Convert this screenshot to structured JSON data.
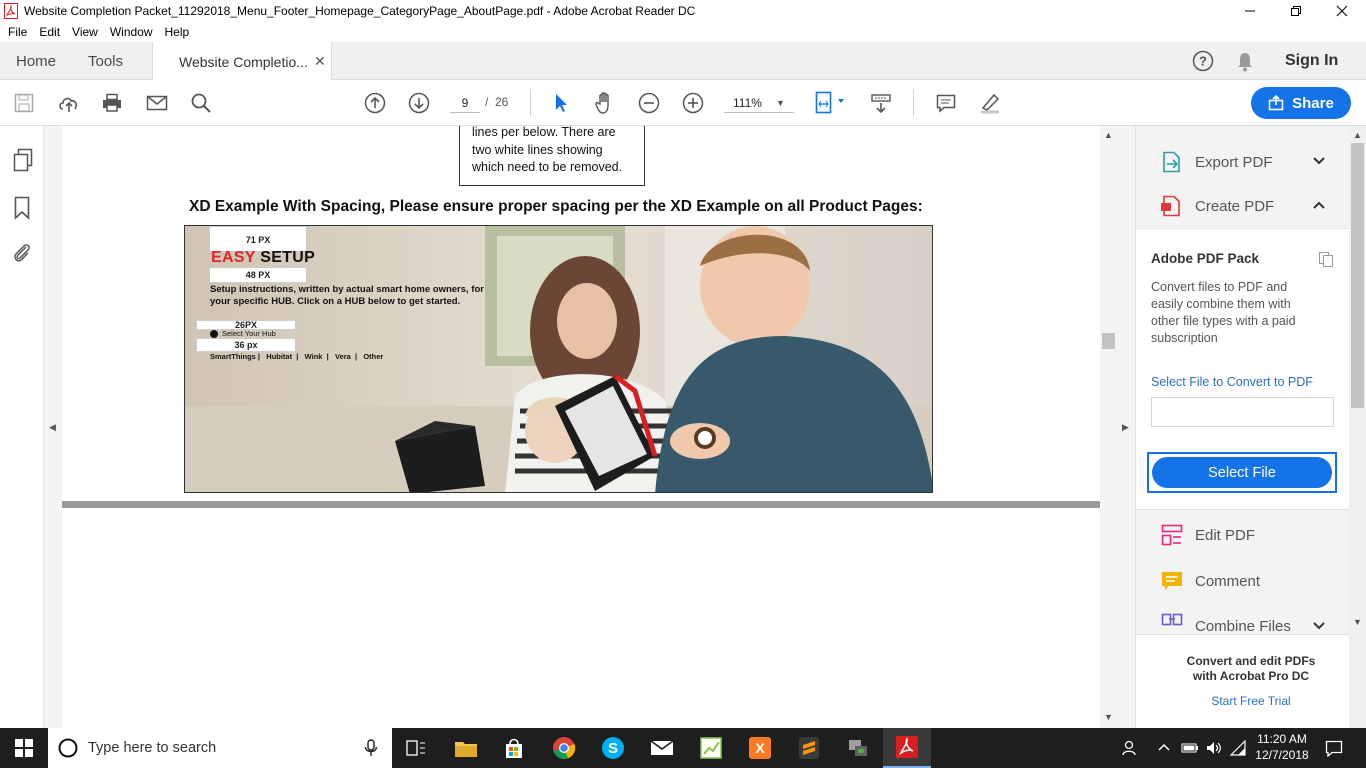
{
  "window": {
    "title": "Website Completion Packet_11292018_Menu_Footer_Homepage_CategoryPage_AboutPage.pdf - Adobe Acrobat Reader DC"
  },
  "menu": [
    "File",
    "Edit",
    "View",
    "Window",
    "Help"
  ],
  "tabs": {
    "home": "Home",
    "tools": "Tools",
    "document": "Website Completio...",
    "sign_in": "Sign In"
  },
  "toolbar": {
    "page_current": "9",
    "page_sep": "/",
    "page_total": "26",
    "zoom": "111%",
    "share": "Share"
  },
  "document": {
    "note_lines": [
      "lines per below. There are",
      "two white lines showing",
      "which need to be removed."
    ],
    "heading": "XD Example With Spacing, Please ensure proper spacing per the XD Example on all Product Pages:",
    "mockup": {
      "label_71": "71 PX",
      "easy": "EASY",
      "setup": "SETUP",
      "label_48": "48 PX",
      "desc": "Setup instructions, written by actual smart home owners, for your specific HUB. Click on a HUB below to get started.",
      "label_26": "26PX",
      "select_hub": "Select Your Hub",
      "label_36": "36 px",
      "hubs": "SmartThings |   Hubitat  |   Wink  |   Vera  |   Other"
    }
  },
  "rightpane": {
    "export_pdf": "Export PDF",
    "create_pdf": "Create PDF",
    "pack_title": "Adobe PDF Pack",
    "pack_desc": "Convert files to PDF and easily combine them with other file types with a paid subscription",
    "select_link": "Select File to Convert to PDF",
    "select_button": "Select File",
    "edit_pdf": "Edit PDF",
    "comment": "Comment",
    "combine": "Combine Files",
    "promo": "Convert and edit PDFs with Acrobat Pro DC",
    "trial": "Start Free Trial"
  },
  "taskbar": {
    "search_placeholder": "Type here to search",
    "time": "11:20 AM",
    "date": "12/7/2018"
  },
  "colors": {
    "accent": "#1473e6",
    "acrobat_red": "#d7201f"
  }
}
